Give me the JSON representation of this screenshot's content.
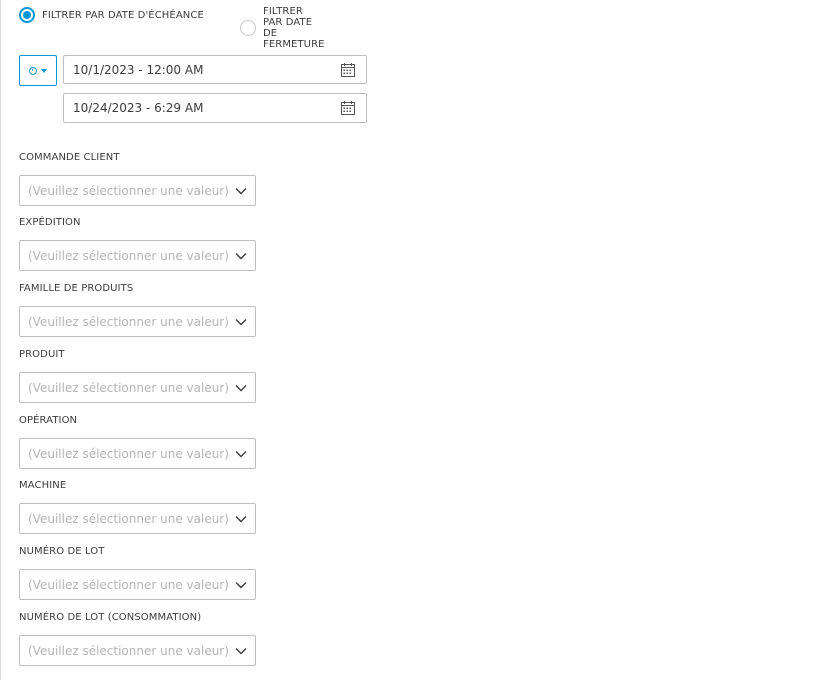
{
  "filter_mode": {
    "options": [
      {
        "label": "FILTRER PAR DATE D'ÉCHÉANCE",
        "selected": true
      },
      {
        "label": "FILTRER PAR DATE DE FERMETURE",
        "selected": false
      }
    ]
  },
  "date_range": {
    "preset_icon": "clock-icon",
    "start": "10/1/2023 - 12:00 AM",
    "end": "10/24/2023 - 6:29 AM"
  },
  "filters": [
    {
      "label": "COMMANDE CLIENT",
      "placeholder": "(Veuillez sélectionner une valeur)"
    },
    {
      "label": "EXPÉDITION",
      "placeholder": "(Veuillez sélectionner une valeur)"
    },
    {
      "label": "FAMILLE DE PRODUITS",
      "placeholder": "(Veuillez sélectionner une valeur)"
    },
    {
      "label": "PRODUIT",
      "placeholder": "(Veuillez sélectionner une valeur)"
    },
    {
      "label": "OPÉRATION",
      "placeholder": "(Veuillez sélectionner une valeur)"
    },
    {
      "label": "MACHINE",
      "placeholder": "(Veuillez sélectionner une valeur)"
    },
    {
      "label": "NUMÉRO DE LOT",
      "placeholder": "(Veuillez sélectionner une valeur)"
    },
    {
      "label": "NUMÉRO DE LOT (CONSOMMATION)",
      "placeholder": "(Veuillez sélectionner une valeur)"
    }
  ],
  "colors": {
    "accent": "#0696d7",
    "border": "#bfbfbf",
    "placeholder": "#b5b5b5"
  }
}
